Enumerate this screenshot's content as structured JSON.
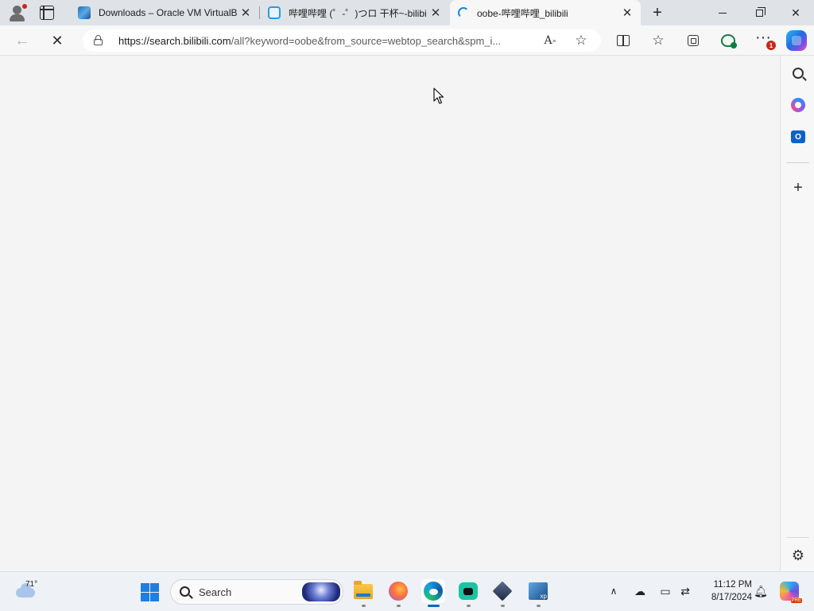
{
  "tabs": [
    {
      "title": "Downloads – Oracle VM VirtualBox",
      "favicon": "virtualbox-icon"
    },
    {
      "title": "哔哩哔哩 (゜-゜)つロ 干杯~-bilibili",
      "favicon": "bilibili-tv-icon"
    },
    {
      "title": "oobe-哔哩哔哩_bilibili",
      "favicon": "loading-spinner-icon",
      "active": true
    }
  ],
  "toolbar": {
    "url_host": "https://search.bilibili.com",
    "url_path": "/all?keyword=oobe&from_source=webtop_search&spm_i...",
    "notification_count": "1"
  },
  "taskbar": {
    "weather_temp": "71°",
    "search_label": "Search",
    "time": "11:12 PM",
    "date": "8/17/2024"
  },
  "colors": {
    "accent": "#0067c0",
    "tabstrip": "#dfe3e7",
    "content_bg": "#f4f4f4"
  }
}
